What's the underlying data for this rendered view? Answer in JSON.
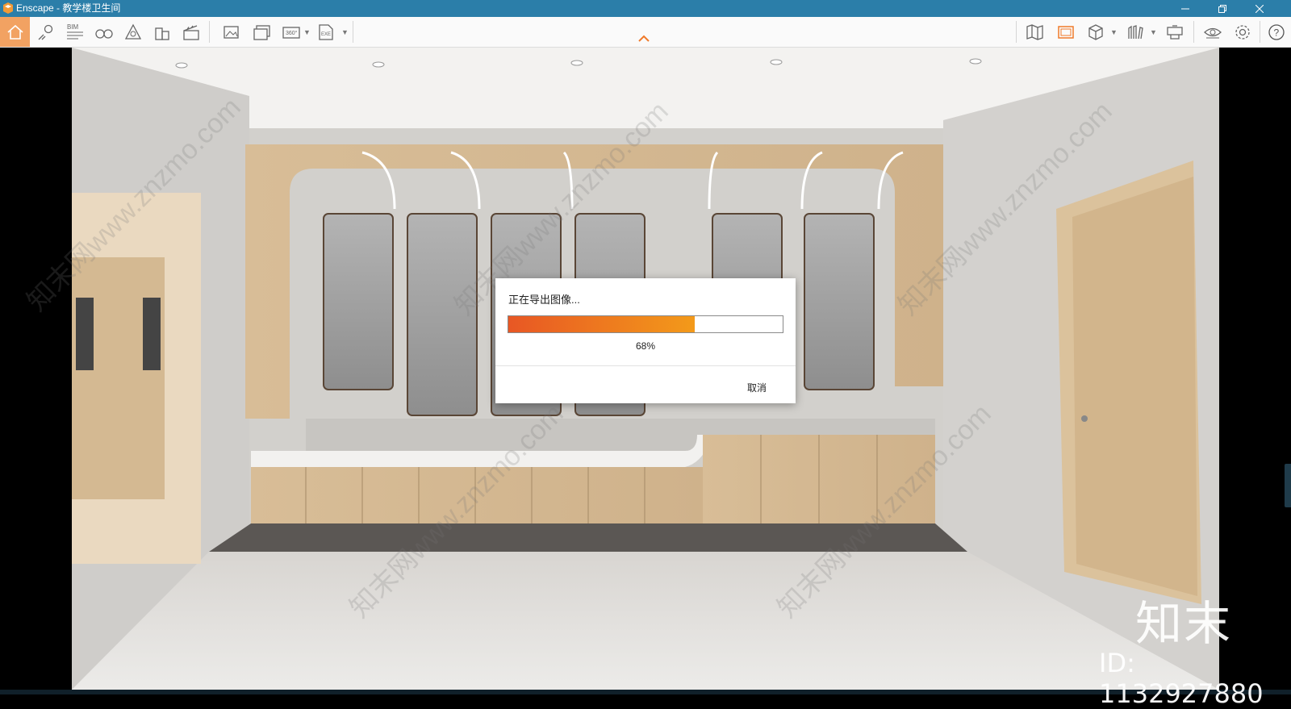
{
  "window": {
    "title": "Enscape - 教学楼卫生间"
  },
  "toolbar": {
    "bim_label": "BIM",
    "pano_label": "360°",
    "exe_label": "EXE"
  },
  "dialog": {
    "title": "正在导出图像...",
    "progress": 0.68,
    "percent_text": "68%",
    "cancel_label": "取消"
  },
  "watermark": {
    "brand": "知末",
    "id_text": "ID: 1132927880",
    "site_text": "知末网www.znzmo.com"
  },
  "colors": {
    "titlebar": "#2b7ea9",
    "active_tab": "#f2a262",
    "accent": "#f07a2a",
    "progress_start": "#e85724",
    "progress_end": "#f39a1a"
  }
}
